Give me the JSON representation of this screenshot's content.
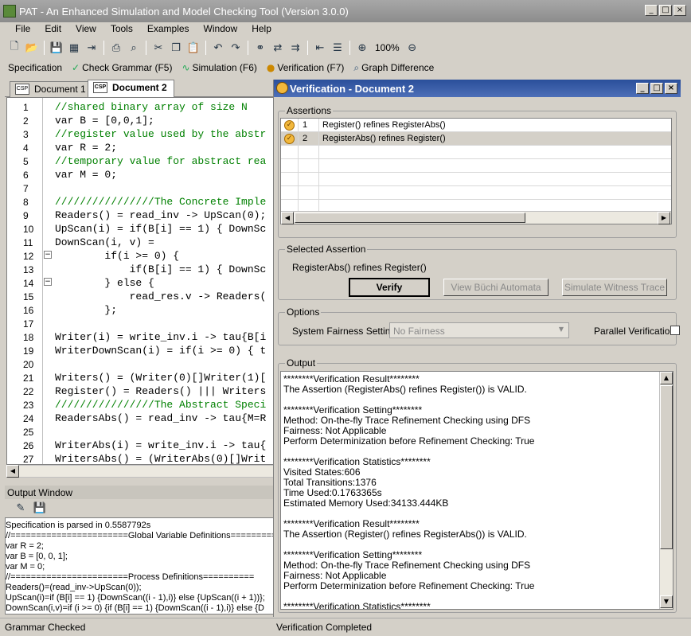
{
  "app": {
    "title": "PAT - An Enhanced Simulation and Model Checking Tool (Version 3.0.0)"
  },
  "menu": [
    "File",
    "Edit",
    "View",
    "Tools",
    "Examples",
    "Window",
    "Help"
  ],
  "toolbar": {
    "zoom": "100%"
  },
  "toolbar2": {
    "specification": "Specification",
    "check_grammar": "Check Grammar (F5)",
    "simulation": "Simulation (F6)",
    "verification": "Verification (F7)",
    "graph_difference": "Graph Difference"
  },
  "tabs": [
    {
      "label": "Document 1",
      "icon": "CSP"
    },
    {
      "label": "Document 2",
      "icon": "CSP"
    }
  ],
  "editor": {
    "lines": [
      {
        "n": "1",
        "code": "//shared binary array of size N",
        "comment": true
      },
      {
        "n": "2",
        "code": "var B = [0,0,1];",
        "comment": false
      },
      {
        "n": "3",
        "code": "//register value used by the abstr",
        "comment": true
      },
      {
        "n": "4",
        "code": "var R = 2;",
        "comment": false
      },
      {
        "n": "5",
        "code": "//temporary value for abstract rea",
        "comment": true
      },
      {
        "n": "6",
        "code": "var M = 0;",
        "comment": false
      },
      {
        "n": "7",
        "code": "",
        "comment": false
      },
      {
        "n": "8",
        "code": "////////////////The Concrete Imple",
        "comment": true
      },
      {
        "n": "9",
        "code": "Readers() = read_inv -> UpScan(0);",
        "comment": false
      },
      {
        "n": "10",
        "code": "UpScan(i) = if(B[i] == 1) { DownSc",
        "comment": false
      },
      {
        "n": "11",
        "code": "DownScan(i, v) =",
        "comment": false
      },
      {
        "n": "12",
        "code": "        if(i >= 0) {",
        "comment": false
      },
      {
        "n": "13",
        "code": "            if(B[i] == 1) { DownSc",
        "comment": false
      },
      {
        "n": "14",
        "code": "        } else {",
        "comment": false
      },
      {
        "n": "15",
        "code": "            read_res.v -> Readers(",
        "comment": false
      },
      {
        "n": "16",
        "code": "        };",
        "comment": false
      },
      {
        "n": "17",
        "code": "",
        "comment": false
      },
      {
        "n": "18",
        "code": "Writer(i) = write_inv.i -> tau{B[i",
        "comment": false
      },
      {
        "n": "19",
        "code": "WriterDownScan(i) = if(i >= 0) { t",
        "comment": false
      },
      {
        "n": "20",
        "code": "",
        "comment": false
      },
      {
        "n": "21",
        "code": "Writers() = (Writer(0)[]Writer(1)[",
        "comment": false
      },
      {
        "n": "22",
        "code": "Register() = Readers() ||| Writers",
        "comment": false
      },
      {
        "n": "23",
        "code": "////////////////The Abstract Speci",
        "comment": true
      },
      {
        "n": "24",
        "code": "ReadersAbs() = read_inv -> tau{M=R",
        "comment": false
      },
      {
        "n": "25",
        "code": "",
        "comment": false
      },
      {
        "n": "26",
        "code": "WriterAbs(i) = write_inv.i -> tau{",
        "comment": false
      },
      {
        "n": "27",
        "code": "WritersAbs() = (WriterAbs(0)[]Writ",
        "comment": false
      }
    ]
  },
  "output_window": {
    "title": "Output Window",
    "lines": [
      "Specification is parsed in 0.5587792s",
      "//=======================Global Variable Definitions==========",
      "var R = 2;",
      "var B = [0, 0, 1];",
      "var M = 0;",
      "//=======================Process Definitions==========",
      "Readers()=(read_inv->UpScan(0));",
      "UpScan(i)=if (B[i] == 1) {DownScan((i - 1),i)} else {UpScan((i + 1))};",
      "DownScan(i,v)=if (i >= 0) {if (B[i] == 1) {DownScan((i - 1),i)} else {D"
    ]
  },
  "status": {
    "left": "Grammar Checked",
    "right": "Verification Completed"
  },
  "verification": {
    "title": "Verification - Document 2",
    "assertions_label": "Assertions",
    "assertions": [
      {
        "id": "1",
        "text": "Register() refines RegisterAbs()"
      },
      {
        "id": "2",
        "text": "RegisterAbs() refines Register()"
      }
    ],
    "selected_label": "Selected Assertion",
    "selected": "RegisterAbs() refines Register()",
    "verify_btn": "Verify",
    "buchi_btn": "View Büchi Automata",
    "witness_btn": "Simulate Witness Trace",
    "options_label": "Options",
    "fairness_label": "System Fairness Setting",
    "fairness_value": "No Fairness",
    "parallel_label": "Parallel Verification",
    "output_label": "Output",
    "output_lines": [
      "********Verification Result********",
      "The Assertion (RegisterAbs() refines Register()) is VALID.",
      "",
      "********Verification Setting********",
      "Method: On-the-fly Trace Refinement Checking using DFS",
      "Fairness: Not Applicable",
      "Perform Determinization before Refinement Checking: True",
      "",
      "********Verification Statistics********",
      "Visited States:606",
      "Total Transitions:1376",
      "Time Used:0.1763365s",
      "Estimated Memory Used:34133.444KB",
      "",
      "********Verification Result********",
      "The Assertion (Register() refines RegisterAbs()) is VALID.",
      "",
      "********Verification Setting********",
      "Method: On-the-fly Trace Refinement Checking using DFS",
      "Fairness: Not Applicable",
      "Perform Determinization before Refinement Checking: True",
      "",
      "********Verification Statistics********"
    ]
  }
}
